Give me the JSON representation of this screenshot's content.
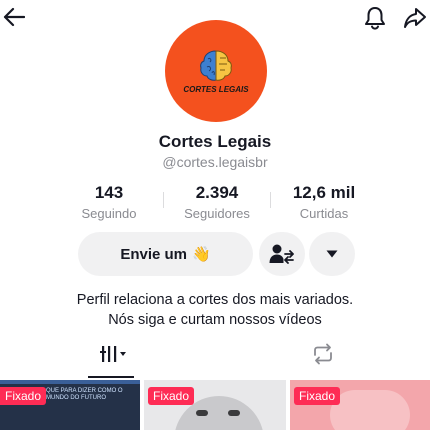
{
  "topbar": {
    "back_icon": "arrow-left-icon",
    "bell_icon": "bell-icon",
    "share_icon": "share-arrow-icon"
  },
  "profile": {
    "avatar_icon": "brain-logo-icon",
    "avatar_text": "CORTES LEGAIS",
    "avatar_bg": "#f4511e",
    "name": "Cortes Legais",
    "handle": "@cortes.legaisbr"
  },
  "stats": [
    {
      "value": "143",
      "label": "Seguindo"
    },
    {
      "value": "2.394",
      "label": "Seguidores"
    },
    {
      "value": "12,6 mil",
      "label": "Curtidas"
    }
  ],
  "actions": {
    "message_label": "Envie um",
    "message_emoji": "👋",
    "follow_icon": "add-friend-icon",
    "more_icon": "caret-down-icon"
  },
  "bio": {
    "line1": "Perfil relaciona a cortes dos mais variados.",
    "line2": "Nós siga e curtam nossos vídeos"
  },
  "tabs": {
    "videos_icon": "grid-columns-icon",
    "repost_icon": "repost-icon"
  },
  "videos": [
    {
      "badge": "Fixado",
      "caption": "QUE PARA DIZER COMO O MUNDO DO FUTURO"
    },
    {
      "badge": "Fixado"
    },
    {
      "badge": "Fixado"
    }
  ],
  "colors": {
    "accent": "#fe2c55",
    "text": "#161823",
    "muted": "#8a8b91",
    "button_bg": "#f1f1f2"
  }
}
